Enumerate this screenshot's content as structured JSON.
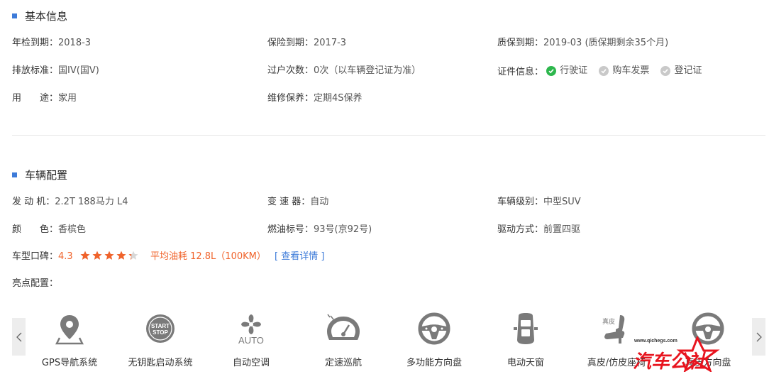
{
  "basic": {
    "title": "基本信息",
    "rows": [
      [
        {
          "label": "年检到期：",
          "value": "2018-3"
        },
        {
          "label": "保险到期：",
          "value": "2017-3"
        },
        {
          "label": "质保到期：",
          "value": "2019-03 (质保期剩余35个月)"
        }
      ],
      [
        {
          "label": "排放标准：",
          "value": "国IV(国V)"
        },
        {
          "label": "过户次数：",
          "value": "0次（以车辆登记证为准）"
        },
        {
          "label": "证件信息：",
          "value": ""
        }
      ],
      [
        {
          "label": "用　　途：",
          "value": "家用"
        },
        {
          "label": "维修保养：",
          "value": "定期4S保养"
        },
        {
          "label": "",
          "value": ""
        }
      ]
    ],
    "certs": [
      {
        "label": "行驶证",
        "status": "on"
      },
      {
        "label": "购车发票",
        "status": "off"
      },
      {
        "label": "登记证",
        "status": "off"
      }
    ]
  },
  "config": {
    "title": "车辆配置",
    "rows": [
      [
        {
          "label": "发 动 机：",
          "value": "2.2T 188马力 L4"
        },
        {
          "label": "变 速 器：",
          "value": "自动"
        },
        {
          "label": "车辆级别：",
          "value": "中型SUV"
        }
      ],
      [
        {
          "label": "颜　　色：",
          "value": "香槟色"
        },
        {
          "label": "燃油标号：",
          "value": "93号(京92号)"
        },
        {
          "label": "驱动方式：",
          "value": "前置四驱"
        }
      ]
    ],
    "koubei_label": "车型口碑：",
    "rating": "4.3",
    "rating_value": 4.3,
    "fuel": "平均油耗 12.8L（100KM）",
    "detail_link": "[ 查看详情 ]",
    "highlight_label": "亮点配置："
  },
  "features": [
    {
      "label": "GPS导航系统",
      "icon": "gps-icon"
    },
    {
      "label": "无钥匙启动系统",
      "icon": "start-stop-icon",
      "icon_text_1": "START",
      "icon_text_2": "STOP"
    },
    {
      "label": "自动空调",
      "icon": "auto-ac-icon",
      "icon_text_1": "AUTO"
    },
    {
      "label": "定速巡航",
      "icon": "cruise-icon"
    },
    {
      "label": "多功能方向盘",
      "icon": "steering-wheel-icon"
    },
    {
      "label": "电动天窗",
      "icon": "sunroof-icon"
    },
    {
      "label": "真皮/仿皮座椅",
      "icon": "leather-seat-icon",
      "icon_text_1": "真皮"
    },
    {
      "label": "真皮方向盘",
      "icon": "leather-wheel-icon"
    }
  ],
  "watermark": {
    "url": "www.qichegs.com",
    "brand": "汽车公社"
  },
  "colors": {
    "accent": "#3d7bd9",
    "orange": "#f0632b",
    "green": "#2db74d",
    "gray": "#c9c9c9"
  }
}
